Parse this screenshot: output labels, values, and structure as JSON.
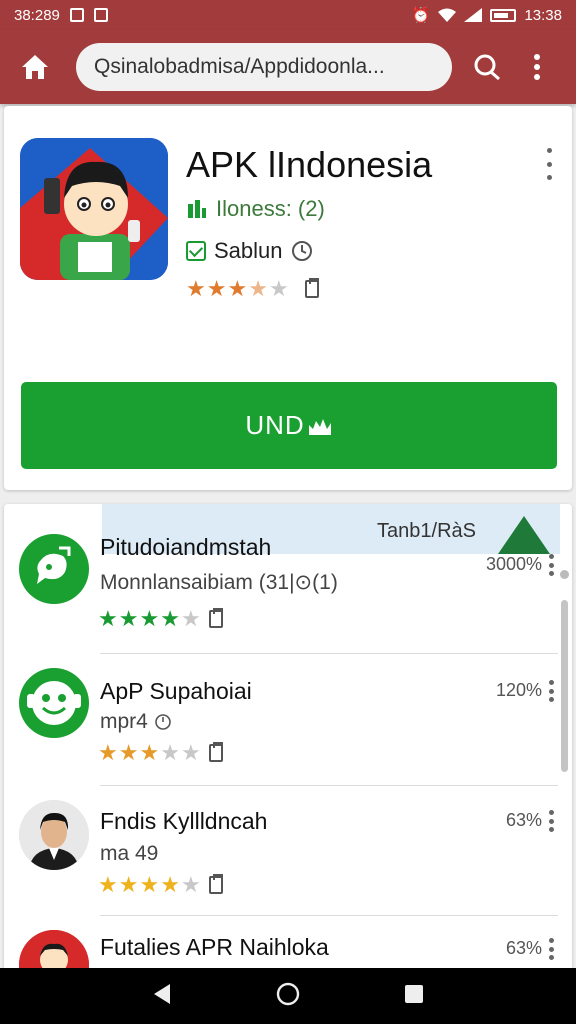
{
  "status_bar": {
    "time_left": "38:289",
    "time_right": "13:38"
  },
  "toolbar": {
    "url_text": "Qsinalobadmisa/Appdidoonla..."
  },
  "app": {
    "title": "APK lIndonesia",
    "developer": "Iloness: (2)",
    "badge_label": "Sablun",
    "rating": 3.5,
    "install_label": "UND",
    "star_color": "#e07a2c",
    "accent_green": "#19a030"
  },
  "banner": {
    "label": "Tanb1/RàS"
  },
  "list": [
    {
      "title": "Pitudoiandmstah",
      "subtitle": "Monnlansaibiam (31|⊙(1)",
      "percent": "3000%",
      "rating": 4,
      "star_color": "#1a9a32",
      "icon": "green-chat-icon"
    },
    {
      "title": "ApP Supahoiai",
      "subtitle": "mpr4",
      "percent": "120%",
      "rating": 3,
      "star_color": "#e59a2a",
      "icon": "green-smiley-icon"
    },
    {
      "title": "Fndis Kyllldncah",
      "subtitle": "ma 49",
      "percent": "63%",
      "rating": 4,
      "star_color": "#eeb21c",
      "icon": "person-avatar"
    },
    {
      "title": "Futalies APR Naihloka",
      "subtitle": "",
      "percent": "63%",
      "rating": 0,
      "star_color": "#eeb21c",
      "icon": "cartoon-avatar"
    }
  ],
  "colors": {
    "header": "#a23c3c",
    "nav_bar": "#000000"
  }
}
